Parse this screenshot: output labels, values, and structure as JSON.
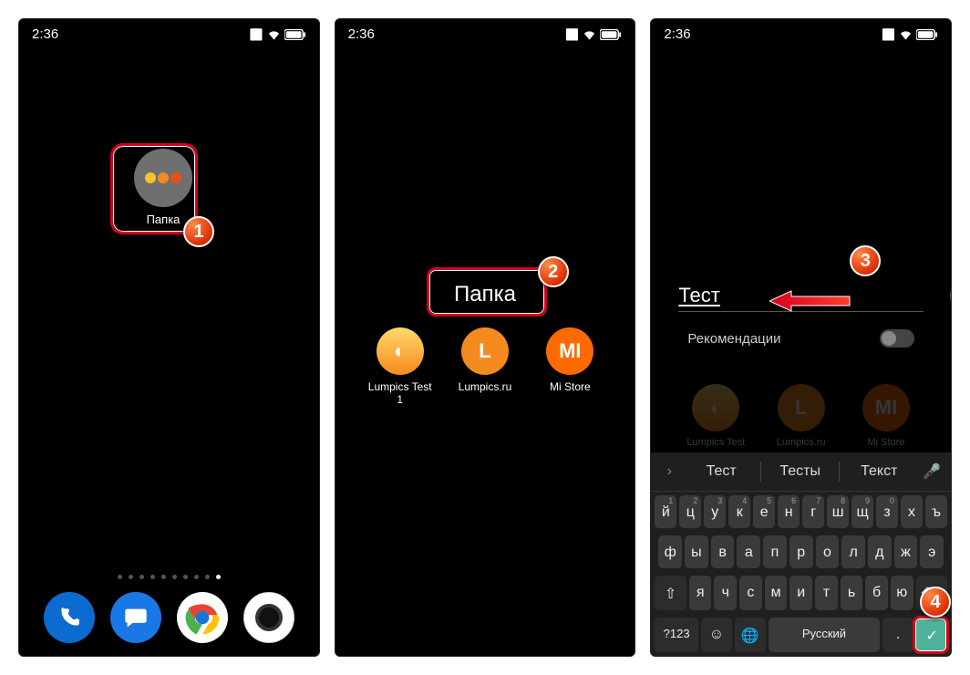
{
  "status": {
    "time": "2:36"
  },
  "screen1": {
    "folder_label": "Папка",
    "badge": "1",
    "dock": [
      "phone",
      "messages",
      "chrome",
      "camera"
    ]
  },
  "screen2": {
    "folder_title": "Папка",
    "badge": "2",
    "apps": [
      {
        "label": "Lumpics Test 1"
      },
      {
        "label": "Lumpics.ru"
      },
      {
        "label": "Mi Store"
      }
    ]
  },
  "screen3": {
    "input_value": "Тест",
    "recommendations_label": "Рекомендации",
    "badge_top": "3",
    "badge_bottom": "4",
    "apps": [
      {
        "label": "Lumpics Test"
      },
      {
        "label": "Lumpics.ru"
      },
      {
        "label": "Mi Store"
      }
    ],
    "suggestions": [
      "Тест",
      "Тесты",
      "Текст"
    ],
    "keyboard": {
      "row_hints": [
        "1",
        "2",
        "3",
        "4",
        "5",
        "6",
        "7",
        "8",
        "9",
        "0",
        "",
        ""
      ],
      "row1": [
        "й",
        "ц",
        "у",
        "к",
        "е",
        "н",
        "г",
        "ш",
        "щ",
        "з",
        "х",
        "ъ"
      ],
      "row2": [
        "ф",
        "ы",
        "в",
        "а",
        "п",
        "р",
        "о",
        "л",
        "д",
        "ж",
        "э"
      ],
      "row3_shift": "⇧",
      "row3": [
        "я",
        "ч",
        "с",
        "м",
        "и",
        "т",
        "ь",
        "б",
        "ю"
      ],
      "row3_back": "⌫",
      "row4": {
        "sym": "?123",
        "emoji": "☺",
        "globe": "🌐",
        "space": "Русский",
        "dot": ".",
        "enter": "✓"
      }
    }
  }
}
